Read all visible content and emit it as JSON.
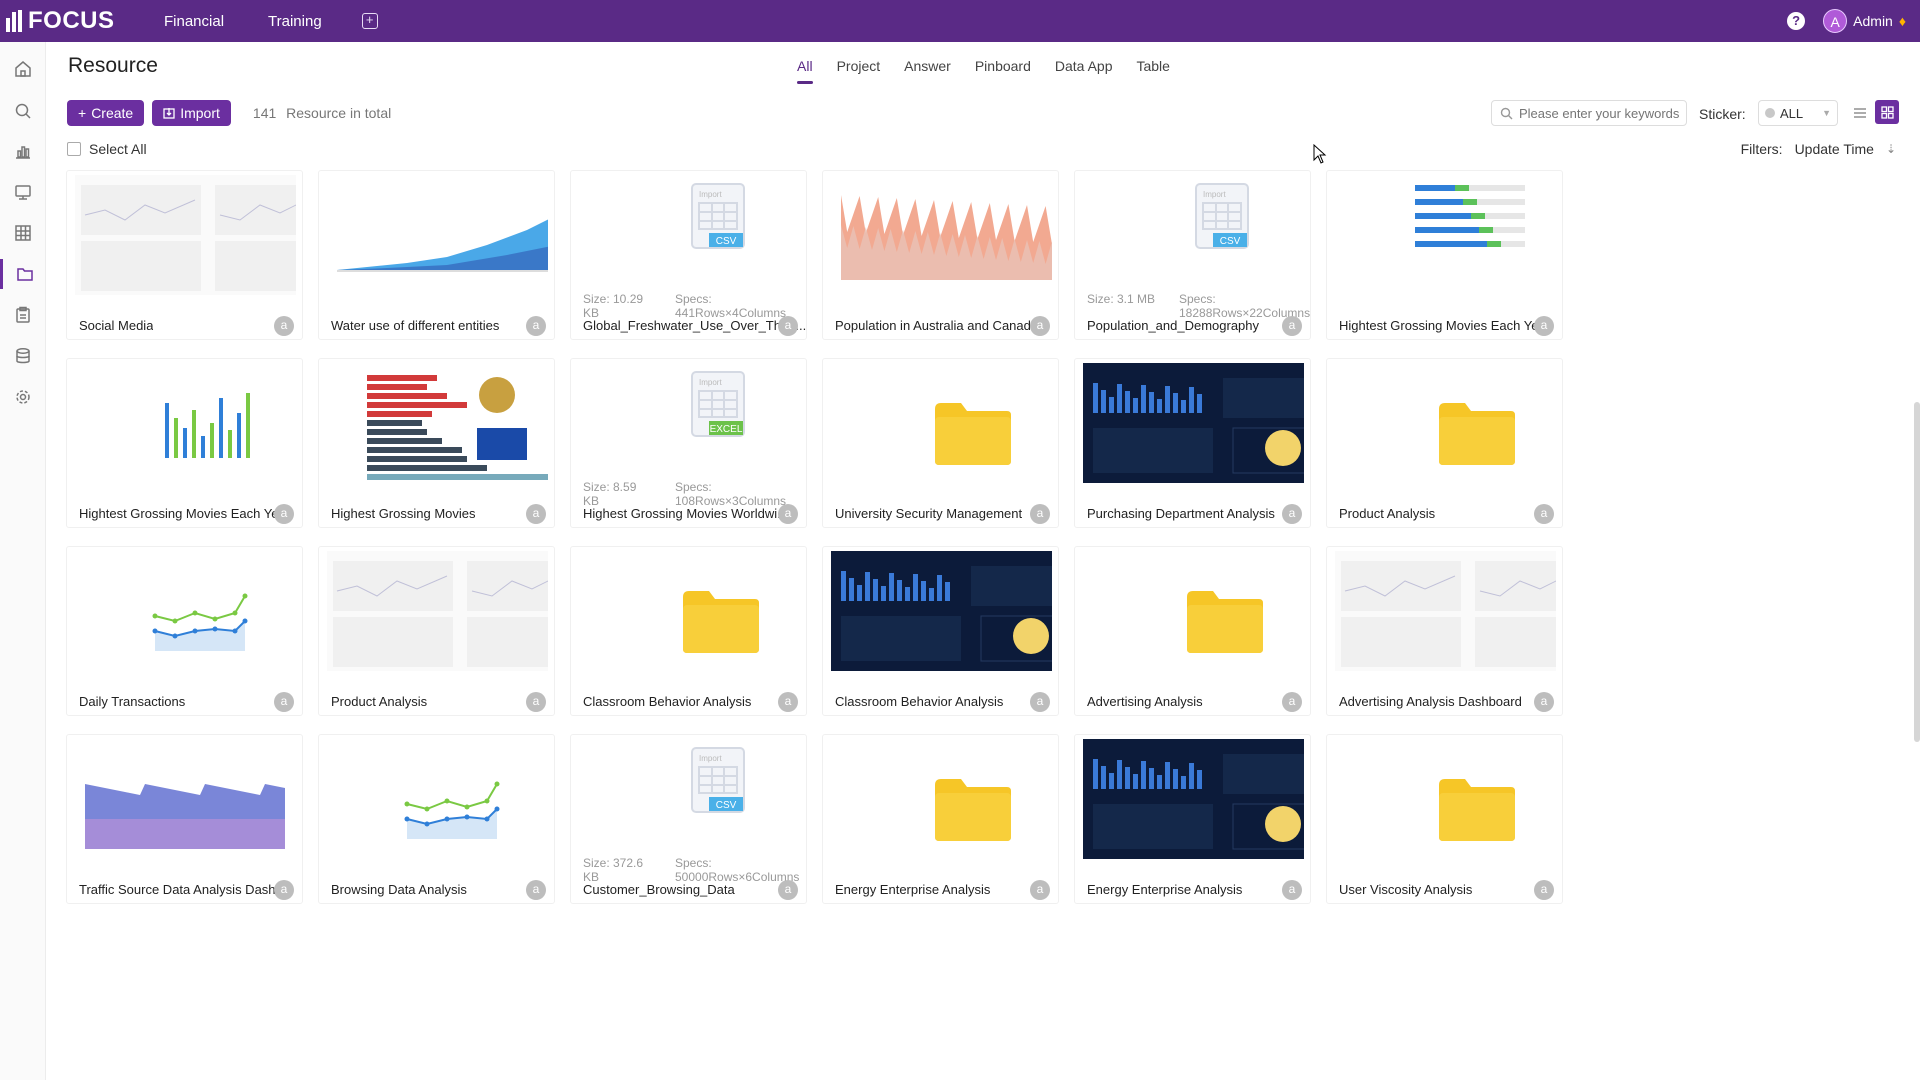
{
  "topbar": {
    "brand": "FOCUS",
    "nav": [
      "Financial",
      "Training"
    ],
    "add_label": "+",
    "help_label": "?",
    "user_initial": "A",
    "user_name": "Admin",
    "colors": {
      "bar": "#5a2a86",
      "accent": "#6b2fa0"
    }
  },
  "sidebar": {
    "icons": [
      "home-icon",
      "search-icon",
      "chart-icon",
      "pinboard-icon",
      "table-icon",
      "resource-icon",
      "clipboard-icon",
      "database-icon",
      "settings-icon"
    ],
    "active": "resource-icon"
  },
  "page": {
    "title": "Resource",
    "tabs": [
      "All",
      "Project",
      "Answer",
      "Pinboard",
      "Data App",
      "Table"
    ],
    "active_tab": "All",
    "create_label": "Create",
    "import_label": "Import",
    "total_count": "141",
    "total_label": "Resource in total",
    "search_placeholder": "Please enter your keywords",
    "sticker_label": "Sticker:",
    "sticker_value": "ALL",
    "select_all_label": "Select All",
    "filters_label": "Filters:",
    "sort_label": "Update Time"
  },
  "cards": [
    {
      "title": "Social Media",
      "kind": "dashboard-light",
      "owner": "a"
    },
    {
      "title": "Water use of different entities",
      "kind": "area-chart",
      "owner": "a"
    },
    {
      "title": "Global_Freshwater_Use_Over_The_...",
      "kind": "csv-file",
      "size": "Size: 10.29 KB",
      "specs": "Specs:  441Rows×4Columns",
      "file_tag": "CSV",
      "owner": "a"
    },
    {
      "title": "Population in Australia and Canada",
      "kind": "pink-area",
      "owner": "a"
    },
    {
      "title": "Population_and_Demography",
      "kind": "csv-file",
      "size": "Size: 3.1 MB",
      "specs": "Specs:  18288Rows×22Columns",
      "file_tag": "CSV",
      "owner": "a"
    },
    {
      "title": "Hightest Grossing Movies Each Ye...",
      "kind": "hbar-chart",
      "owner": "a"
    },
    {
      "title": "Hightest Grossing Movies Each Ye...",
      "kind": "vbar-chart",
      "owner": "a"
    },
    {
      "title": "Highest Grossing Movies",
      "kind": "movies-chart",
      "owner": "a"
    },
    {
      "title": "Highest Grossing Movies Worldwi...",
      "kind": "excel-file",
      "size": "Size: 8.59 KB",
      "specs": "Specs:  108Rows×3Columns",
      "file_tag": "EXCEL",
      "owner": "a"
    },
    {
      "title": "University Security Management",
      "kind": "folder",
      "owner": "a"
    },
    {
      "title": "Purchasing Department Analysis",
      "kind": "dark-dashboard",
      "owner": "a"
    },
    {
      "title": "Product Analysis",
      "kind": "folder",
      "owner": "a"
    },
    {
      "title": "Daily Transactions",
      "kind": "line-chart",
      "owner": "a"
    },
    {
      "title": "Product Analysis",
      "kind": "dashboard-light2",
      "owner": "a"
    },
    {
      "title": "Classroom Behavior Analysis",
      "kind": "folder",
      "owner": "a"
    },
    {
      "title": "Classroom Behavior Analysis",
      "kind": "dark-dashboard2",
      "owner": "a"
    },
    {
      "title": "Advertising Analysis",
      "kind": "folder",
      "owner": "a"
    },
    {
      "title": "Advertising Analysis Dashboard",
      "kind": "dashboard-light3",
      "owner": "a"
    },
    {
      "title": "Traffic Source Data Analysis Dash...",
      "kind": "purple-area",
      "owner": "a"
    },
    {
      "title": "Browsing Data Analysis",
      "kind": "line-chart",
      "owner": "a"
    },
    {
      "title": "Customer_Browsing_Data",
      "kind": "csv-file",
      "size": "Size: 372.6 KB",
      "specs": "Specs:  50000Rows×6Columns",
      "file_tag": "CSV",
      "owner": "a"
    },
    {
      "title": "Energy Enterprise Analysis",
      "kind": "folder",
      "owner": "a"
    },
    {
      "title": "Energy Enterprise Analysis",
      "kind": "dark-dashboard3",
      "owner": "a"
    },
    {
      "title": "User Viscosity Analysis",
      "kind": "folder",
      "owner": "a"
    }
  ]
}
